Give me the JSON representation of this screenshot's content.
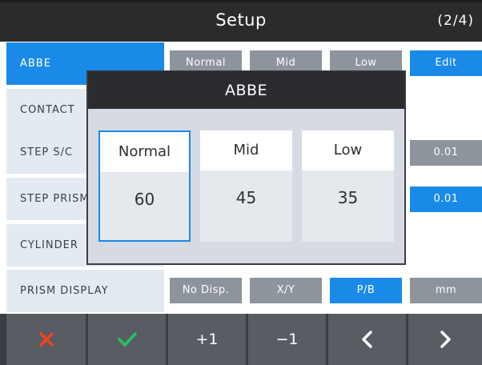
{
  "header": {
    "title": "Setup",
    "page": "(2/4)"
  },
  "settings": [
    {
      "label": "ABBE",
      "options": [
        "Normal",
        "Mid",
        "Low",
        "Edit"
      ]
    },
    {
      "label": "CONTACT"
    },
    {
      "label": "STEP S/C",
      "options": [
        "0.01"
      ]
    },
    {
      "label": "STEP PRISM",
      "options": [
        "0.01"
      ]
    },
    {
      "label": "CYLINDER"
    },
    {
      "label": "PRISM DISPLAY",
      "options": [
        "No Disp.",
        "X/Y",
        "P/B",
        "mm"
      ]
    }
  ],
  "dialog": {
    "title": "ABBE",
    "choices": [
      {
        "label": "Normal",
        "value": "60"
      },
      {
        "label": "Mid",
        "value": "45"
      },
      {
        "label": "Low",
        "value": "35"
      }
    ]
  },
  "toolbar": {
    "plus": "+1",
    "minus": "−1"
  },
  "icons": [
    "cancel-icon",
    "confirm-icon",
    "chevron-left-icon",
    "chevron-right-icon"
  ],
  "colors": {
    "accent": "#1a8ae8",
    "header": "#2b2b2b",
    "cancel": "#f0451e",
    "confirm": "#22c55e"
  }
}
